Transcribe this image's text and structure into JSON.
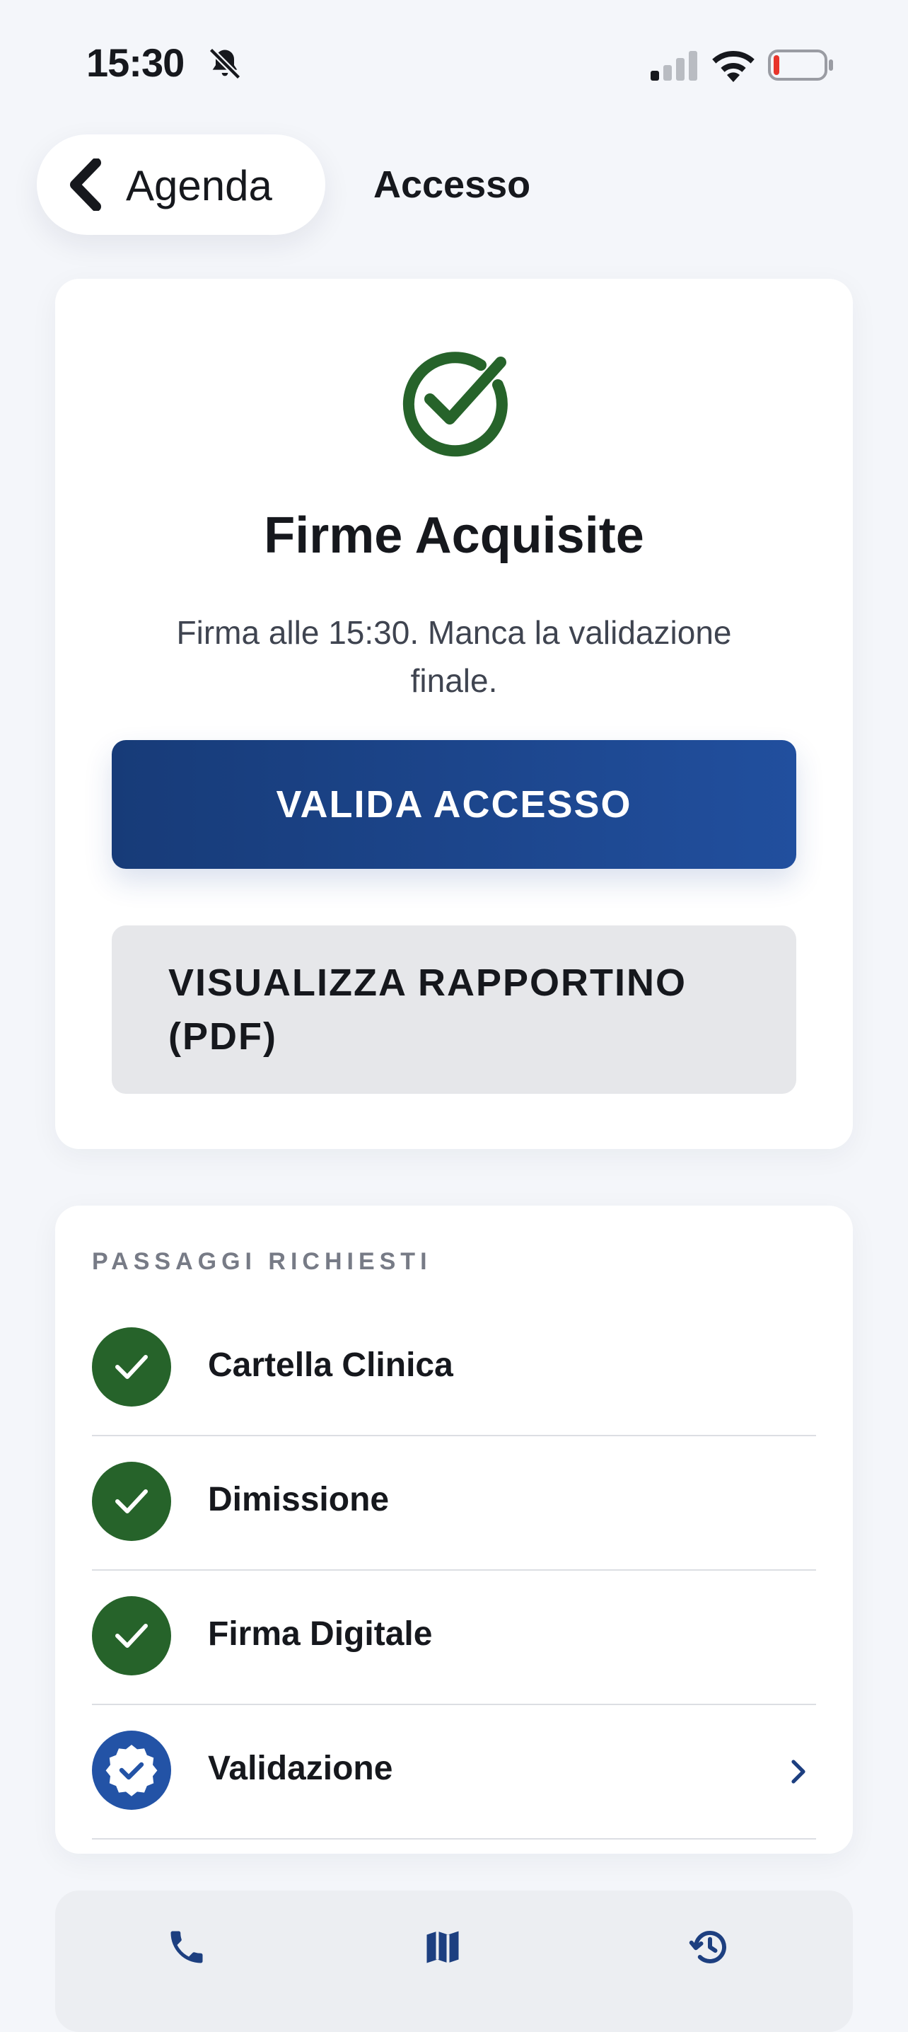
{
  "status_bar": {
    "time": "15:30"
  },
  "nav": {
    "back_label": "Agenda",
    "title": "Accesso"
  },
  "result_card": {
    "title": "Firme Acquisite",
    "subtitle": "Firma alle 15:30. Manca la validazione finale.",
    "primary_button": "VALIDA ACCESSO",
    "secondary_button": "VISUALIZZA RAPPORTINO (PDF)"
  },
  "steps_card": {
    "section_label": "PASSAGGI RICHIESTI",
    "steps": [
      {
        "label": "Cartella Clinica",
        "state": "done"
      },
      {
        "label": "Dimissione",
        "state": "done"
      },
      {
        "label": "Firma Digitale",
        "state": "done"
      },
      {
        "label": "Validazione",
        "state": "pending"
      }
    ]
  },
  "colors": {
    "success_green": "#26632a",
    "primary_blue": "#1d4791",
    "background": "#f4f6fa"
  },
  "icons": {
    "status": [
      "bell-slash-icon",
      "cellular-signal-icon",
      "wifi-icon",
      "battery-low-icon"
    ],
    "bottom_tabs": [
      "phone-icon",
      "map-icon",
      "history-icon"
    ]
  }
}
